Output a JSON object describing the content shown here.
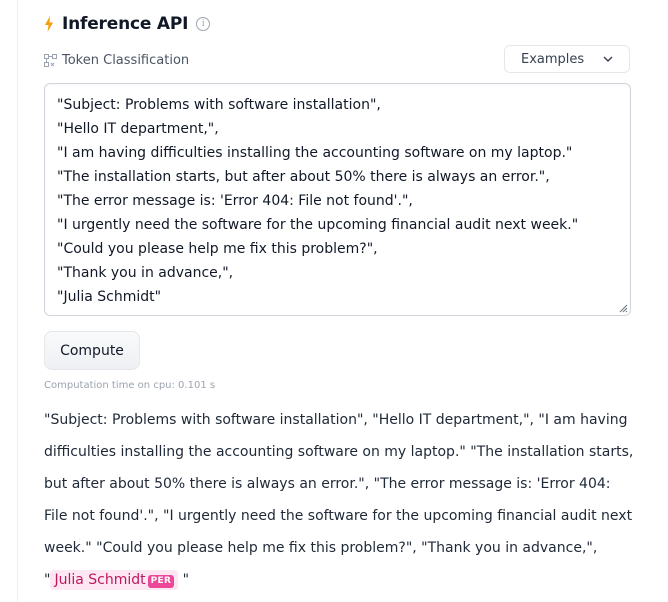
{
  "header": {
    "title": "Inference API"
  },
  "task": {
    "label": "Token Classification"
  },
  "examples": {
    "label": "Examples"
  },
  "input": {
    "lines": [
      "\"Subject: Problems with software installation\",",
      "\"Hello IT department,\",",
      "\"I am having difficulties installing the accounting software on my laptop.\"",
      "\"The installation starts, but after about 50% there is always an error.\",",
      "\"The error message is: 'Error 404: File not found'.\",",
      "\"I urgently need the software for the upcoming financial audit next week.\"",
      "\"Could you please help me fix this problem?\",",
      "\"Thank you in advance,\",",
      "\"Julia Schmidt\""
    ]
  },
  "compute": {
    "label": "Compute"
  },
  "computation_time": "Computation time on cpu: 0.101 s",
  "output": {
    "before": "\"Subject: Problems with software installation\", \"Hello IT department,\", \"I am having difficulties installing the accounting software on my laptop.\" \"The installation starts, but after about 50% there is always an error.\", \"The error message is: 'Error 404: File not found'.\", \"I urgently need the software for the upcoming financial audit next week.\" \"Could you please help me fix this problem?\", \"Thank you in advance,\", \"",
    "entity_text": "Julia Schmidt",
    "entity_tag": "PER",
    "after": "\""
  },
  "colors": {
    "bolt": "#f59e0b",
    "entity_bg": "#fce7f3",
    "entity_text": "#be185d",
    "tag_bg": "#ec4899"
  }
}
